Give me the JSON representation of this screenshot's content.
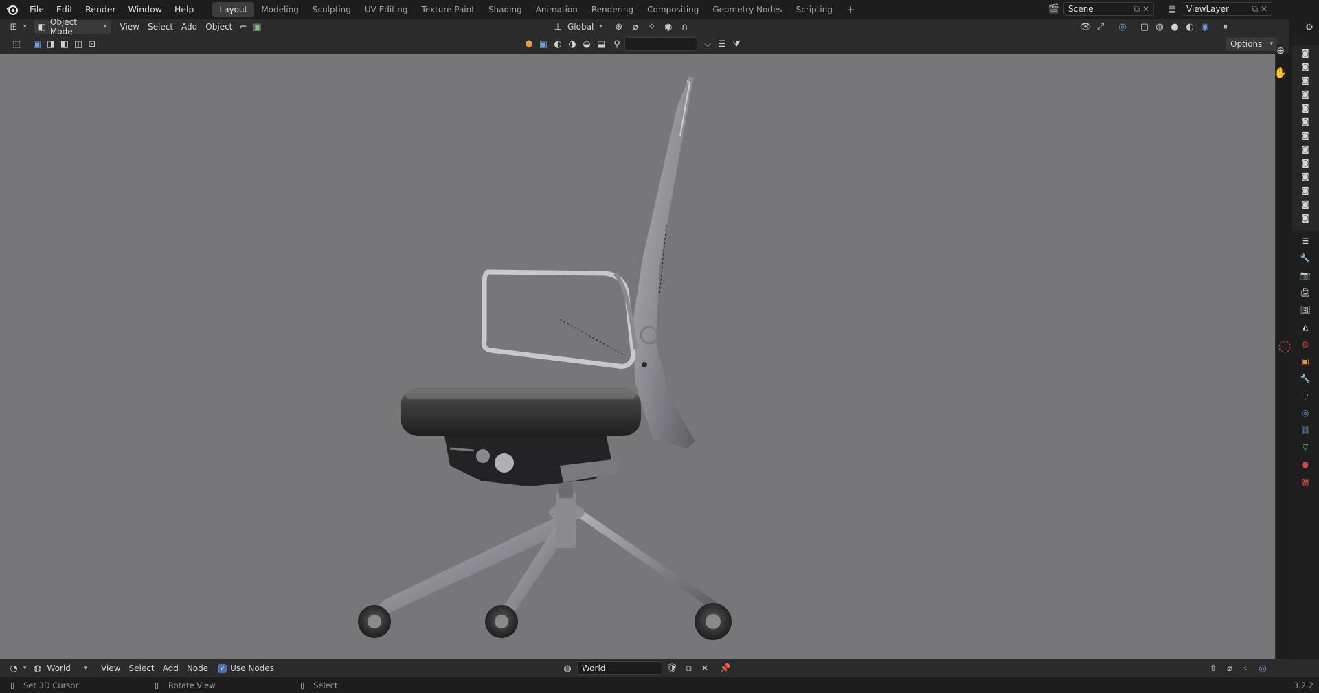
{
  "top_menu": {
    "items": [
      "File",
      "Edit",
      "Render",
      "Window",
      "Help"
    ]
  },
  "workspaces": {
    "tabs": [
      "Layout",
      "Modeling",
      "Sculpting",
      "UV Editing",
      "Texture Paint",
      "Shading",
      "Animation",
      "Rendering",
      "Compositing",
      "Geometry Nodes",
      "Scripting"
    ],
    "active": "Layout",
    "add_label": "+"
  },
  "scene": {
    "name": "Scene"
  },
  "view_layer": {
    "name": "ViewLayer"
  },
  "viewport_header": {
    "mode": "Object Mode",
    "menus": [
      "View",
      "Select",
      "Add",
      "Object"
    ],
    "orientation": "Global",
    "options_label": "Options",
    "search_placeholder": ""
  },
  "node_header": {
    "world_type": "World",
    "menus": [
      "View",
      "Select",
      "Add",
      "Node"
    ],
    "use_nodes_label": "Use Nodes",
    "use_nodes_checked": true,
    "world_name": "World"
  },
  "status_bar": {
    "left_hint": "Set 3D Cursor",
    "middle_hint": "Rotate View",
    "right_hint": "Select",
    "version": "3.2.2"
  },
  "colors": {
    "viewport_bg": "#777679",
    "header_bg": "#2b2b2b",
    "top_bg": "#1d1d1d",
    "accent_blue": "#4772b3"
  }
}
